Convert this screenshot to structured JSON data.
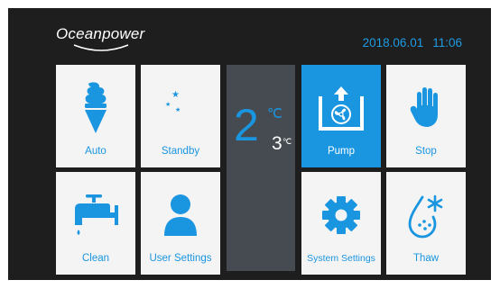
{
  "brand": {
    "name": "Oceanpower"
  },
  "header": {
    "date": "2018.06.01",
    "time": "11:06"
  },
  "temperature": {
    "main_value": "2",
    "main_unit": "℃",
    "sub_value": "3",
    "sub_unit": "℃"
  },
  "tiles": {
    "auto": {
      "label": "Auto",
      "icon": "ice-cream-icon"
    },
    "standby": {
      "label": "Standby",
      "icon": "moon-stars-icon"
    },
    "pump": {
      "label": "Pump",
      "icon": "pump-icon",
      "active": true
    },
    "stop": {
      "label": "Stop",
      "icon": "hand-icon"
    },
    "clean": {
      "label": "Clean",
      "icon": "faucet-icon"
    },
    "user_settings": {
      "label": "User Settings",
      "icon": "user-icon"
    },
    "system_settings": {
      "label": "System Settings",
      "icon": "gear-icon"
    },
    "thaw": {
      "label": "Thaw",
      "icon": "thaw-drop-icon"
    }
  },
  "colors": {
    "accent": "#1a95e0",
    "screen_bg": "#1e1e1e",
    "tile_bg": "#f4f4f4",
    "temp_panel_bg": "#454b51"
  }
}
